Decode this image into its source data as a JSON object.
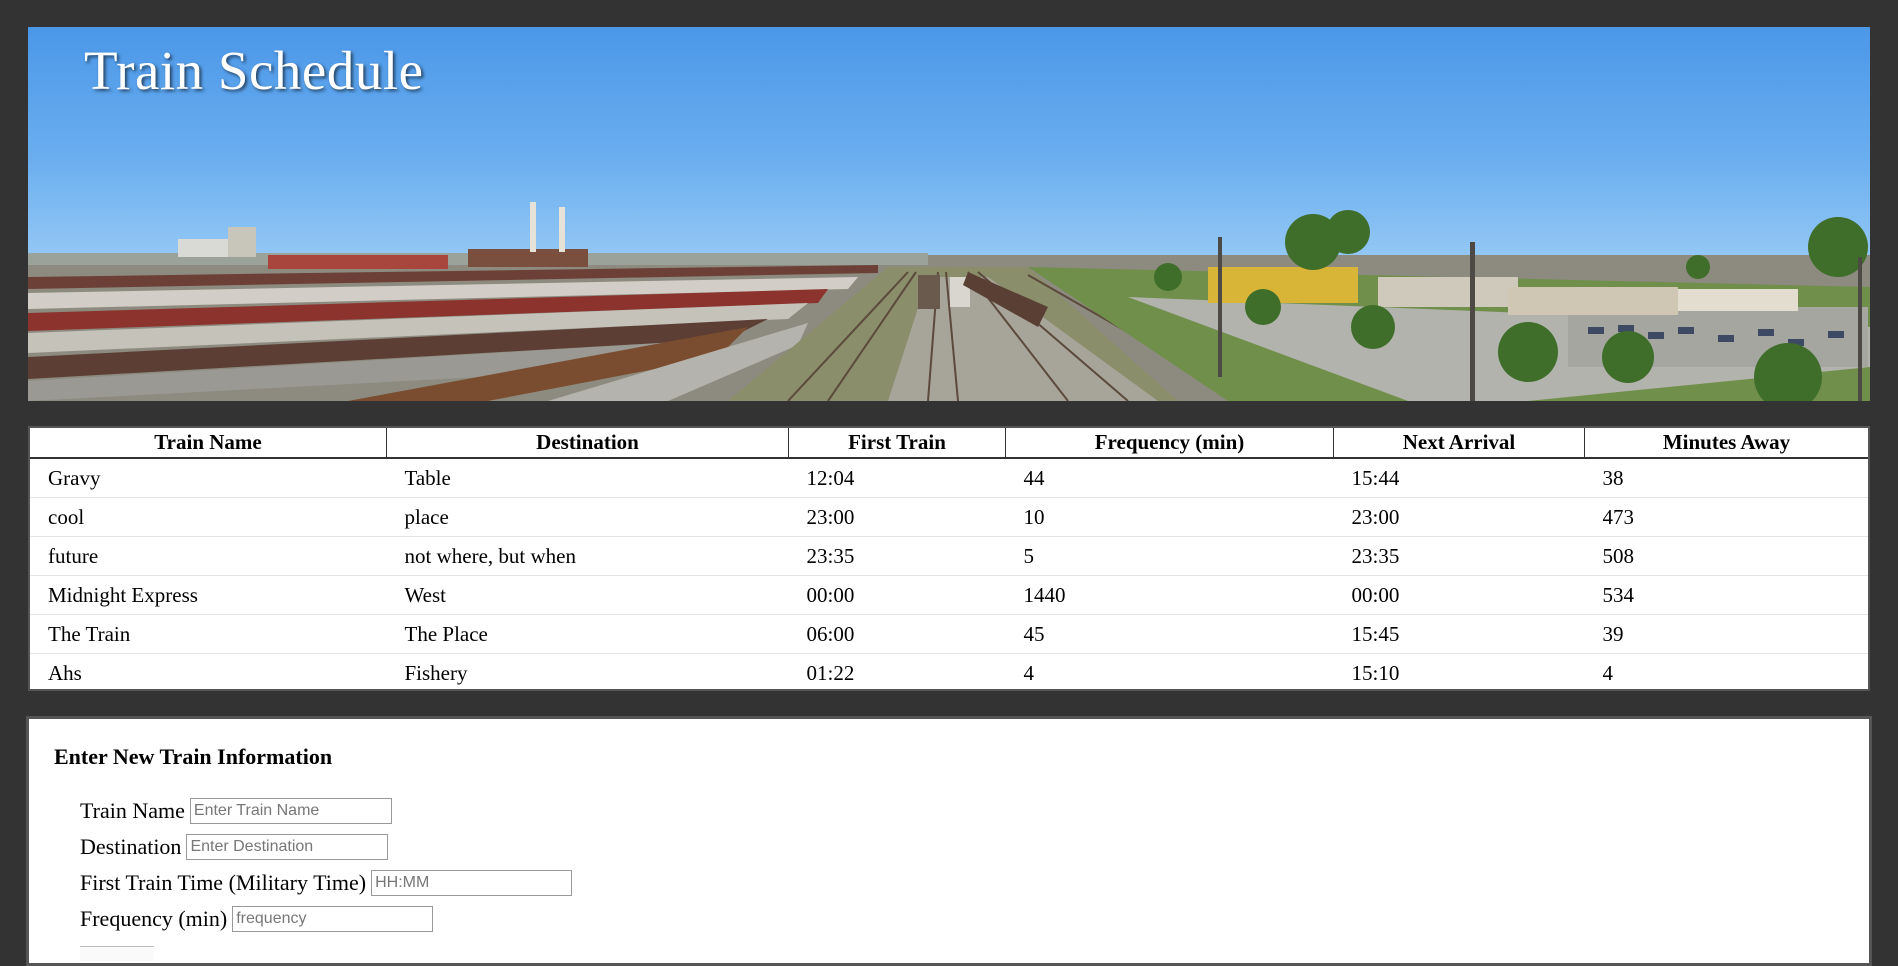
{
  "header": {
    "title": "Train Schedule"
  },
  "table": {
    "columns": [
      "Train Name",
      "Destination",
      "First Train",
      "Frequency (min)",
      "Next Arrival",
      "Minutes Away"
    ],
    "rows": [
      {
        "name": "Gravy",
        "destination": "Table",
        "first": "12:04",
        "frequency": "44",
        "next": "15:44",
        "away": "38"
      },
      {
        "name": "cool",
        "destination": "place",
        "first": "23:00",
        "frequency": "10",
        "next": "23:00",
        "away": "473"
      },
      {
        "name": "future",
        "destination": "not where, but when",
        "first": "23:35",
        "frequency": "5",
        "next": "23:35",
        "away": "508"
      },
      {
        "name": "Midnight Express",
        "destination": "West",
        "first": "00:00",
        "frequency": "1440",
        "next": "00:00",
        "away": "534"
      },
      {
        "name": "The Train",
        "destination": "The Place",
        "first": "06:00",
        "frequency": "45",
        "next": "15:45",
        "away": "39"
      },
      {
        "name": "Ahs",
        "destination": "Fishery",
        "first": "01:22",
        "frequency": "4",
        "next": "15:10",
        "away": "4"
      }
    ]
  },
  "form": {
    "heading": "Enter New Train Information",
    "name_label": "Train Name",
    "name_placeholder": "Enter Train Name",
    "destination_label": "Destination",
    "destination_placeholder": "Enter Destination",
    "first_label": "First Train Time (Military Time)",
    "first_placeholder": "HH:MM",
    "frequency_label": "Frequency (min)",
    "frequency_placeholder": "frequency"
  },
  "colors": {
    "page_background": "#333333",
    "panel_background": "#ffffff",
    "sky": "#5fa6ee",
    "title_text": "#ffffff"
  }
}
